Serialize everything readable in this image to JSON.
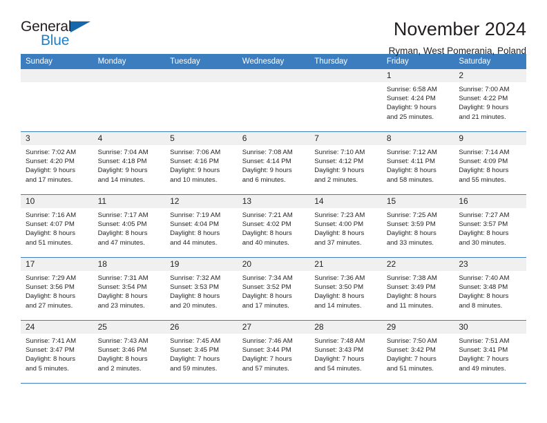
{
  "brand": {
    "word_general": "General",
    "word_blue": "Blue",
    "logo_icon": "triangle-icon"
  },
  "header": {
    "title": "November 2024",
    "subtitle": "Ryman, West Pomerania, Poland"
  },
  "calendar": {
    "weekday_headers": [
      "Sunday",
      "Monday",
      "Tuesday",
      "Wednesday",
      "Thursday",
      "Friday",
      "Saturday"
    ],
    "accent_color": "#3b7dbf",
    "daynum_band_color": "#f0f0f0",
    "weeks": [
      [
        {
          "day": "",
          "lines": []
        },
        {
          "day": "",
          "lines": []
        },
        {
          "day": "",
          "lines": []
        },
        {
          "day": "",
          "lines": []
        },
        {
          "day": "",
          "lines": []
        },
        {
          "day": "1",
          "lines": [
            "Sunrise: 6:58 AM",
            "Sunset: 4:24 PM",
            "Daylight: 9 hours",
            "and 25 minutes."
          ]
        },
        {
          "day": "2",
          "lines": [
            "Sunrise: 7:00 AM",
            "Sunset: 4:22 PM",
            "Daylight: 9 hours",
            "and 21 minutes."
          ]
        }
      ],
      [
        {
          "day": "3",
          "lines": [
            "Sunrise: 7:02 AM",
            "Sunset: 4:20 PM",
            "Daylight: 9 hours",
            "and 17 minutes."
          ]
        },
        {
          "day": "4",
          "lines": [
            "Sunrise: 7:04 AM",
            "Sunset: 4:18 PM",
            "Daylight: 9 hours",
            "and 14 minutes."
          ]
        },
        {
          "day": "5",
          "lines": [
            "Sunrise: 7:06 AM",
            "Sunset: 4:16 PM",
            "Daylight: 9 hours",
            "and 10 minutes."
          ]
        },
        {
          "day": "6",
          "lines": [
            "Sunrise: 7:08 AM",
            "Sunset: 4:14 PM",
            "Daylight: 9 hours",
            "and 6 minutes."
          ]
        },
        {
          "day": "7",
          "lines": [
            "Sunrise: 7:10 AM",
            "Sunset: 4:12 PM",
            "Daylight: 9 hours",
            "and 2 minutes."
          ]
        },
        {
          "day": "8",
          "lines": [
            "Sunrise: 7:12 AM",
            "Sunset: 4:11 PM",
            "Daylight: 8 hours",
            "and 58 minutes."
          ]
        },
        {
          "day": "9",
          "lines": [
            "Sunrise: 7:14 AM",
            "Sunset: 4:09 PM",
            "Daylight: 8 hours",
            "and 55 minutes."
          ]
        }
      ],
      [
        {
          "day": "10",
          "lines": [
            "Sunrise: 7:16 AM",
            "Sunset: 4:07 PM",
            "Daylight: 8 hours",
            "and 51 minutes."
          ]
        },
        {
          "day": "11",
          "lines": [
            "Sunrise: 7:17 AM",
            "Sunset: 4:05 PM",
            "Daylight: 8 hours",
            "and 47 minutes."
          ]
        },
        {
          "day": "12",
          "lines": [
            "Sunrise: 7:19 AM",
            "Sunset: 4:04 PM",
            "Daylight: 8 hours",
            "and 44 minutes."
          ]
        },
        {
          "day": "13",
          "lines": [
            "Sunrise: 7:21 AM",
            "Sunset: 4:02 PM",
            "Daylight: 8 hours",
            "and 40 minutes."
          ]
        },
        {
          "day": "14",
          "lines": [
            "Sunrise: 7:23 AM",
            "Sunset: 4:00 PM",
            "Daylight: 8 hours",
            "and 37 minutes."
          ]
        },
        {
          "day": "15",
          "lines": [
            "Sunrise: 7:25 AM",
            "Sunset: 3:59 PM",
            "Daylight: 8 hours",
            "and 33 minutes."
          ]
        },
        {
          "day": "16",
          "lines": [
            "Sunrise: 7:27 AM",
            "Sunset: 3:57 PM",
            "Daylight: 8 hours",
            "and 30 minutes."
          ]
        }
      ],
      [
        {
          "day": "17",
          "lines": [
            "Sunrise: 7:29 AM",
            "Sunset: 3:56 PM",
            "Daylight: 8 hours",
            "and 27 minutes."
          ]
        },
        {
          "day": "18",
          "lines": [
            "Sunrise: 7:31 AM",
            "Sunset: 3:54 PM",
            "Daylight: 8 hours",
            "and 23 minutes."
          ]
        },
        {
          "day": "19",
          "lines": [
            "Sunrise: 7:32 AM",
            "Sunset: 3:53 PM",
            "Daylight: 8 hours",
            "and 20 minutes."
          ]
        },
        {
          "day": "20",
          "lines": [
            "Sunrise: 7:34 AM",
            "Sunset: 3:52 PM",
            "Daylight: 8 hours",
            "and 17 minutes."
          ]
        },
        {
          "day": "21",
          "lines": [
            "Sunrise: 7:36 AM",
            "Sunset: 3:50 PM",
            "Daylight: 8 hours",
            "and 14 minutes."
          ]
        },
        {
          "day": "22",
          "lines": [
            "Sunrise: 7:38 AM",
            "Sunset: 3:49 PM",
            "Daylight: 8 hours",
            "and 11 minutes."
          ]
        },
        {
          "day": "23",
          "lines": [
            "Sunrise: 7:40 AM",
            "Sunset: 3:48 PM",
            "Daylight: 8 hours",
            "and 8 minutes."
          ]
        }
      ],
      [
        {
          "day": "24",
          "lines": [
            "Sunrise: 7:41 AM",
            "Sunset: 3:47 PM",
            "Daylight: 8 hours",
            "and 5 minutes."
          ]
        },
        {
          "day": "25",
          "lines": [
            "Sunrise: 7:43 AM",
            "Sunset: 3:46 PM",
            "Daylight: 8 hours",
            "and 2 minutes."
          ]
        },
        {
          "day": "26",
          "lines": [
            "Sunrise: 7:45 AM",
            "Sunset: 3:45 PM",
            "Daylight: 7 hours",
            "and 59 minutes."
          ]
        },
        {
          "day": "27",
          "lines": [
            "Sunrise: 7:46 AM",
            "Sunset: 3:44 PM",
            "Daylight: 7 hours",
            "and 57 minutes."
          ]
        },
        {
          "day": "28",
          "lines": [
            "Sunrise: 7:48 AM",
            "Sunset: 3:43 PM",
            "Daylight: 7 hours",
            "and 54 minutes."
          ]
        },
        {
          "day": "29",
          "lines": [
            "Sunrise: 7:50 AM",
            "Sunset: 3:42 PM",
            "Daylight: 7 hours",
            "and 51 minutes."
          ]
        },
        {
          "day": "30",
          "lines": [
            "Sunrise: 7:51 AM",
            "Sunset: 3:41 PM",
            "Daylight: 7 hours",
            "and 49 minutes."
          ]
        }
      ]
    ]
  }
}
